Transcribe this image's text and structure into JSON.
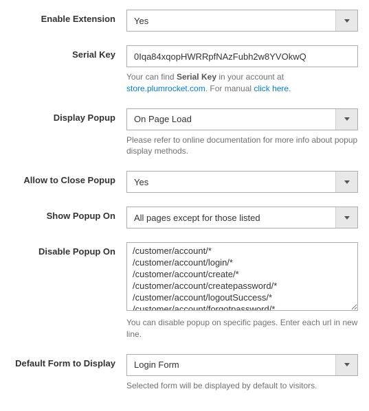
{
  "enable_extension": {
    "label": "Enable Extension",
    "value": "Yes"
  },
  "serial_key": {
    "label": "Serial Key",
    "value": "0Iqa84xqopHWRRpfNAzFubh2w8YVOkwQ",
    "note_pre": "Your can find ",
    "note_strong": "Serial Key",
    "note_mid": " in your account at ",
    "note_link": "store.plumrocket.com",
    "note_mid2": ". For manual ",
    "note_link2": "click here",
    "note_post": "."
  },
  "display_popup": {
    "label": "Display Popup",
    "value": "On Page Load",
    "note": "Please refer to online documentation for more info about popup display methods."
  },
  "allow_close": {
    "label": "Allow to Close Popup",
    "value": "Yes"
  },
  "show_on": {
    "label": "Show Popup On",
    "value": "All pages except for those listed"
  },
  "disable_on": {
    "label": "Disable Popup On",
    "value": "/customer/account/*\n/customer/account/login/*\n/customer/account/create/*\n/customer/account/createpassword/*\n/customer/account/logoutSuccess/*\n/customer/account/forgotpassword/*",
    "note": "You can disable popup on specific pages. Enter each url in new line."
  },
  "default_form": {
    "label": "Default Form to Display",
    "value": "Login Form",
    "note": "Selected form will be displayed by default to visitors."
  }
}
